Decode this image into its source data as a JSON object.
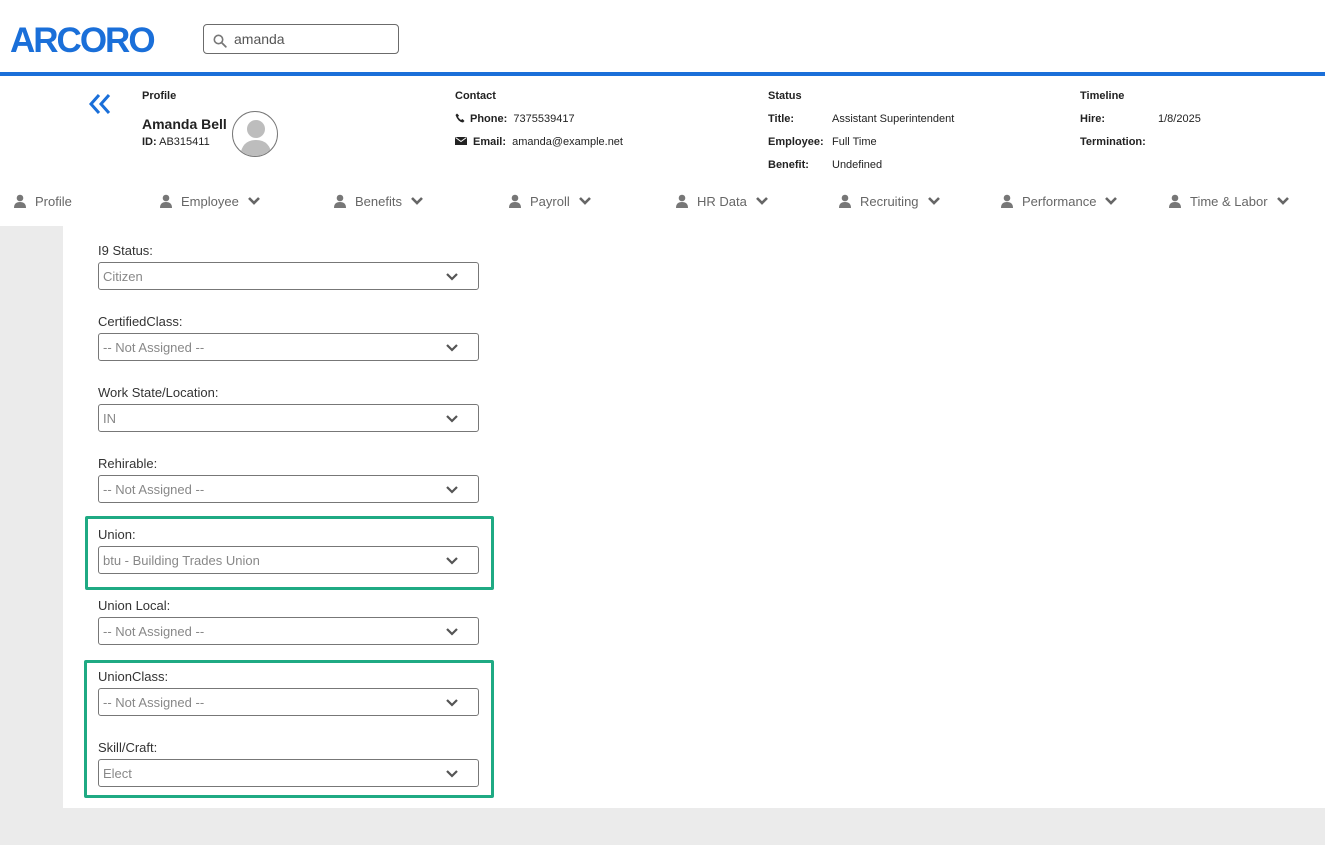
{
  "brand": {
    "logo_text": "ARCORO",
    "accent_color": "#1a6fd9",
    "highlight_color": "#1faa83"
  },
  "search": {
    "value": "amanda",
    "icon": "search-icon"
  },
  "profile": {
    "heading": "Profile",
    "name": "Amanda Bell",
    "id_label": "ID:",
    "id_value": "AB315411"
  },
  "contact": {
    "heading": "Contact",
    "phone_label": "Phone:",
    "phone_value": "7375539417",
    "email_label": "Email:",
    "email_value": "amanda@example.net"
  },
  "status": {
    "heading": "Status",
    "title_label": "Title:",
    "title_value": "Assistant Superintendent",
    "employee_label": "Employee:",
    "employee_value": "Full Time",
    "benefit_label": "Benefit:",
    "benefit_value": "Undefined"
  },
  "timeline": {
    "heading": "Timeline",
    "hire_label": "Hire:",
    "hire_value": "1/8/2025",
    "termination_label": "Termination:",
    "termination_value": ""
  },
  "nav": [
    {
      "label": "Profile"
    },
    {
      "label": "Employee"
    },
    {
      "label": "Benefits"
    },
    {
      "label": "Payroll"
    },
    {
      "label": "HR Data"
    },
    {
      "label": "Recruiting"
    },
    {
      "label": "Performance"
    },
    {
      "label": "Time & Labor"
    }
  ],
  "fields": [
    {
      "label": "I9 Status:",
      "value": "Citizen"
    },
    {
      "label": "CertifiedClass:",
      "value": "-- Not Assigned --"
    },
    {
      "label": "Work State/Location:",
      "value": "IN"
    },
    {
      "label": "Rehirable:",
      "value": "-- Not Assigned --"
    },
    {
      "label": "Union:",
      "value": "btu - Building Trades Union"
    },
    {
      "label": "Union Local:",
      "value": "-- Not Assigned --"
    },
    {
      "label": "UnionClass:",
      "value": "-- Not Assigned --"
    },
    {
      "label": "Skill/Craft:",
      "value": "Elect"
    }
  ]
}
